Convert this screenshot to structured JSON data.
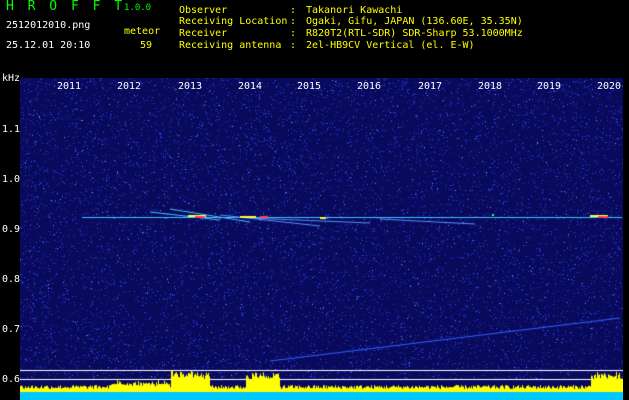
{
  "header": {
    "app_name": "H R O F F T",
    "version": "1.0.0",
    "filename": "2512012010.png",
    "mode_label": "meteor",
    "datetime": "25.12.01 20:10",
    "meteor_count": "59"
  },
  "station_info": [
    {
      "label": "Observer",
      "value": "Takanori Kawachi"
    },
    {
      "label": "Receiving Location",
      "value": "Ogaki, Gifu, JAPAN (136.60E, 35.35N)"
    },
    {
      "label": "Receiver",
      "value": "R820T2(RTL-SDR) SDR-Sharp 53.1000MHz"
    },
    {
      "label": "Receiving antenna",
      "value": "2el-HB9CV Vertical (el. E-W)"
    }
  ],
  "colon": ":",
  "spectrogram": {
    "y_unit": "kHz",
    "y_ticks": [
      "1.1",
      "1.0",
      "0.9",
      "0.8",
      "0.7",
      "0.6"
    ],
    "x_ticks": [
      "2011",
      "2012",
      "2013",
      "2014",
      "2015",
      "2016",
      "2017",
      "2018",
      "2019",
      "2020"
    ],
    "colors": {
      "background": "#0a0a5c",
      "noise_a": "#2a4aff",
      "noise_b": "#1a2fbf",
      "carrier": "#40c0ff",
      "meteor_hot": "#ff4060",
      "meteor_warm": "#ffff40",
      "bottom_band": "#00c8ff",
      "bottom_peaks": "#ffff00",
      "ref_lines": "#ffffff"
    }
  }
}
